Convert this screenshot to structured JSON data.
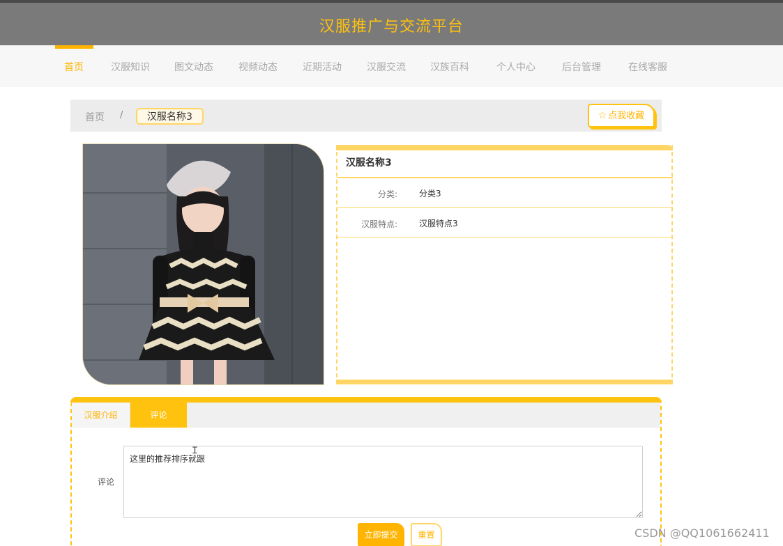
{
  "header": {
    "site_title": "汉服推广与交流平台"
  },
  "nav": {
    "items": [
      {
        "label": "首页",
        "active": true
      },
      {
        "label": "汉服知识"
      },
      {
        "label": "图文动态"
      },
      {
        "label": "视频动态"
      },
      {
        "label": "近期活动"
      },
      {
        "label": "汉服交流"
      },
      {
        "label": "汉族百科"
      },
      {
        "label": "个人中心"
      },
      {
        "label": "后台管理"
      },
      {
        "label": "在线客服"
      }
    ]
  },
  "breadcrumb": {
    "home": "首页",
    "separator": "/",
    "current": "汉服名称3"
  },
  "favorite_button": {
    "label": "点我收藏",
    "icon": "star-outline-icon"
  },
  "product": {
    "name": "汉服名称3",
    "fields": [
      {
        "label": "分类:",
        "value": "分类3"
      },
      {
        "label": "汉服特点:",
        "value": "汉服特点3"
      }
    ]
  },
  "tabs": {
    "intro_label": "汉服介绍",
    "comment_label": "评论",
    "active": "评论"
  },
  "comment_form": {
    "label": "评论",
    "value": "这里的推荐排序就跟",
    "submit_label": "立即提交",
    "reset_label": "重置"
  },
  "watermark": "CSDN @QQ1061662411",
  "colors": {
    "accent": "#ffb400",
    "accent_light": "#ffd666",
    "header_bg": "#7a7a7a",
    "title_color": "#ffc20e"
  }
}
